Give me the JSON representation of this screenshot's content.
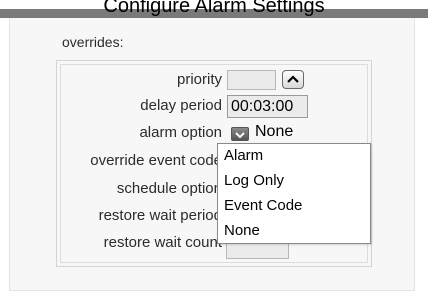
{
  "window": {
    "title": "Configure Alarm Settings"
  },
  "section": {
    "label": "overrides:"
  },
  "rows": {
    "priority": {
      "label": "priority",
      "value": ""
    },
    "delay_period": {
      "label": "delay period",
      "value": "00:03:00"
    },
    "alarm_option": {
      "label": "alarm option",
      "value": "None"
    },
    "override_event_code": {
      "label": "override event code"
    },
    "schedule_option": {
      "label": "schedule option"
    },
    "restore_wait_period": {
      "label": "restore wait period"
    },
    "restore_wait_count": {
      "label": "restore wait count"
    }
  },
  "dropdown": {
    "options": [
      "Alarm",
      "Log Only",
      "Event Code",
      "None"
    ]
  },
  "icons": {
    "spin": "chevron-up-icon",
    "dropdown": "chevron-down-icon"
  },
  "colors": {
    "panel_bg": "#f7f7f7",
    "field_bg": "#ebebeb",
    "title_bar": "#7a7a7a"
  }
}
